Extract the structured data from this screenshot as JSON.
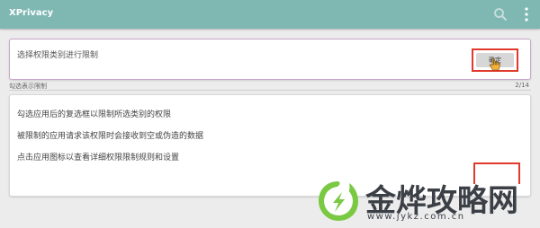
{
  "app": {
    "title": "XPrivacy"
  },
  "toolbar": {
    "search_icon": "search-icon",
    "menu_icon": "more-vert-icon"
  },
  "category_prompt": {
    "text": "选择权限类别进行限制",
    "button_label": "确定"
  },
  "selection": {
    "label": "勾选表示限制",
    "count": "2/14"
  },
  "info": [
    "勾选应用后的复选框以限制所选类别的权限",
    "被限制的应用请求该权限时会接收到空或伪造的数据",
    "点击应用图标以查看详细权限限制规则和设置"
  ],
  "watermark": {
    "title": "金烨攻略网",
    "url": "www.jykz.com.cn"
  },
  "colors": {
    "titlebar": "#7fb8b3",
    "highlight": "#e03a2c",
    "logo_green": "#7ac943"
  }
}
